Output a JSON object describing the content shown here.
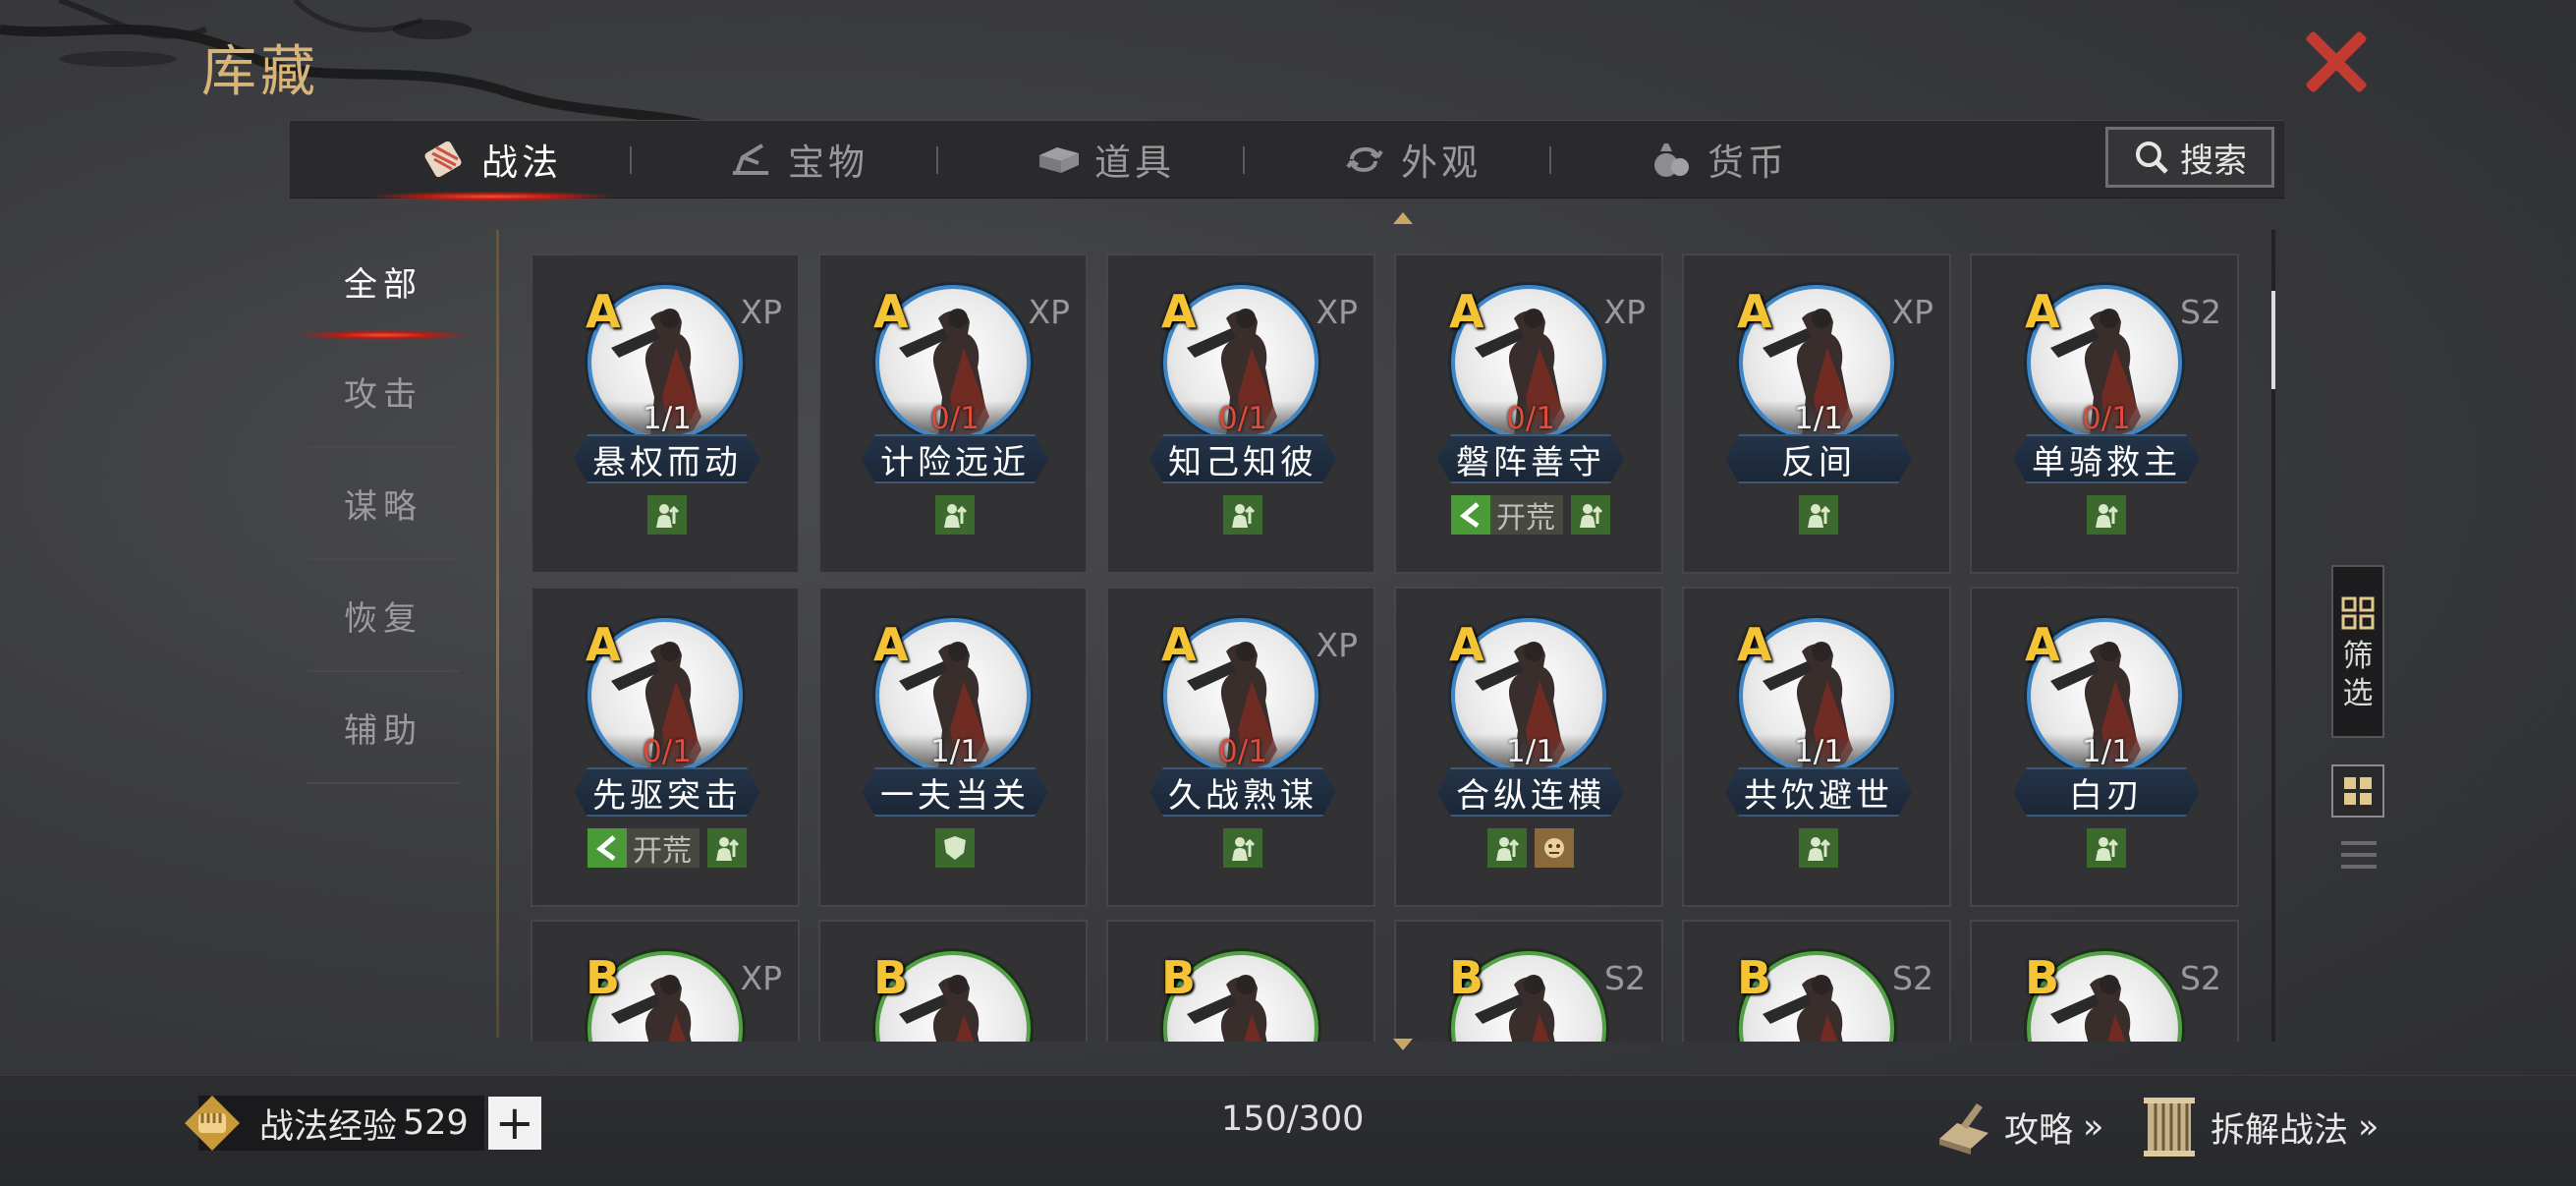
{
  "header": {
    "title": "库藏"
  },
  "tabs": [
    {
      "label": "战法",
      "icon": "scroll-icon",
      "active": true
    },
    {
      "label": "宝物",
      "icon": "treasure-icon",
      "active": false
    },
    {
      "label": "道具",
      "icon": "item-box-icon",
      "active": false
    },
    {
      "label": "外观",
      "icon": "appearance-icon",
      "active": false
    },
    {
      "label": "货币",
      "icon": "money-bag-icon",
      "active": false
    }
  ],
  "search": {
    "label": "搜索"
  },
  "sidebar": {
    "items": [
      {
        "label": "全部",
        "active": true
      },
      {
        "label": "攻击"
      },
      {
        "label": "谋略"
      },
      {
        "label": "恢复"
      },
      {
        "label": "辅助"
      }
    ]
  },
  "cards": [
    {
      "rank": "A",
      "tag": "XP",
      "count": "1/1",
      "name": "悬权而动",
      "traits": [
        "troop"
      ]
    },
    {
      "rank": "A",
      "tag": "XP",
      "count": "0/1",
      "name": "计险远近",
      "traits": [
        "troop"
      ]
    },
    {
      "rank": "A",
      "tag": "XP",
      "count": "0/1",
      "name": "知己知彼",
      "traits": [
        "troop"
      ]
    },
    {
      "rank": "A",
      "tag": "XP",
      "count": "0/1",
      "name": "磐阵善守",
      "kaihuang": "开荒",
      "traits": [
        "troop"
      ]
    },
    {
      "rank": "A",
      "tag": "XP",
      "count": "1/1",
      "name": "反间",
      "traits": [
        "troop"
      ]
    },
    {
      "rank": "A",
      "tag": "S2",
      "count": "0/1",
      "name": "单骑救主",
      "traits": [
        "troop"
      ]
    },
    {
      "rank": "A",
      "tag": "",
      "count": "0/1",
      "name": "先驱突击",
      "kaihuang": "开荒",
      "traits": [
        "troop"
      ]
    },
    {
      "rank": "A",
      "tag": "",
      "count": "1/1",
      "name": "一夫当关",
      "traits": [
        "shield"
      ]
    },
    {
      "rank": "A",
      "tag": "XP",
      "count": "0/1",
      "name": "久战熟谋",
      "traits": [
        "troop"
      ]
    },
    {
      "rank": "A",
      "tag": "",
      "count": "1/1",
      "name": "合纵连横",
      "traits": [
        "troop",
        "gold"
      ]
    },
    {
      "rank": "A",
      "tag": "",
      "count": "1/1",
      "name": "共饮避世",
      "traits": [
        "troop"
      ]
    },
    {
      "rank": "A",
      "tag": "",
      "count": "1/1",
      "name": "白刃",
      "traits": [
        "troop"
      ]
    },
    {
      "rank": "B",
      "tag": "XP",
      "count": "",
      "name": "",
      "traits": []
    },
    {
      "rank": "B",
      "tag": "",
      "count": "",
      "name": "",
      "traits": []
    },
    {
      "rank": "B",
      "tag": "",
      "count": "",
      "name": "",
      "traits": []
    },
    {
      "rank": "B",
      "tag": "S2",
      "count": "",
      "name": "",
      "traits": []
    },
    {
      "rank": "B",
      "tag": "S2",
      "count": "",
      "name": "",
      "traits": []
    },
    {
      "rank": "B",
      "tag": "S2",
      "count": "",
      "name": "",
      "traits": []
    }
  ],
  "filter": {
    "label": "筛选"
  },
  "footer": {
    "exp_label": "战法经验",
    "exp_value": "529",
    "capacity": "150/300",
    "strategy_label": "攻略",
    "dismantle_label": "拆解战法",
    "more_glyph": "»"
  },
  "colors": {
    "accent": "#d6b47a",
    "rank": "#f5c435",
    "count_red": "#e04a3a",
    "close": "#c23a30"
  }
}
